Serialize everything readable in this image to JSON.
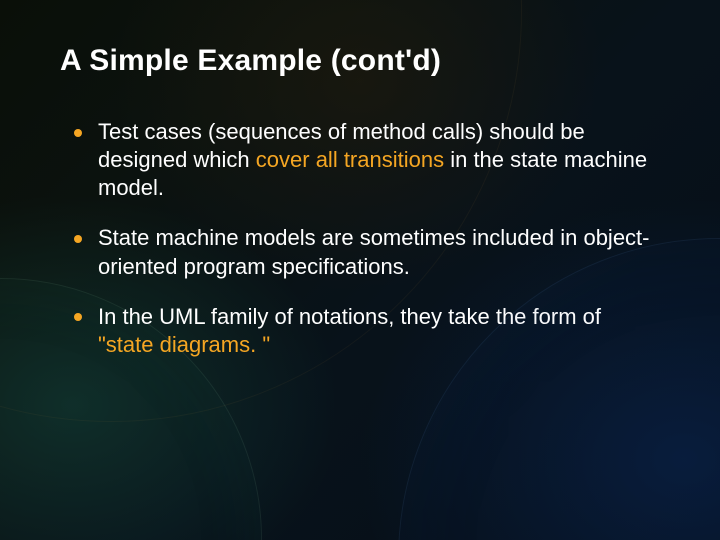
{
  "title": "A Simple Example (cont'd)",
  "bullets": [
    {
      "pre": "Test cases (sequences of method calls) should be designed which ",
      "hl": "cover all transitions",
      "post": " in the state machine model."
    },
    {
      "pre": "State machine models are sometimes included in object-oriented program specifications.",
      "hl": "",
      "post": ""
    },
    {
      "pre": "In the UML family of notations, they take the form of ",
      "hl": "\"state diagrams. \"",
      "post": ""
    }
  ]
}
